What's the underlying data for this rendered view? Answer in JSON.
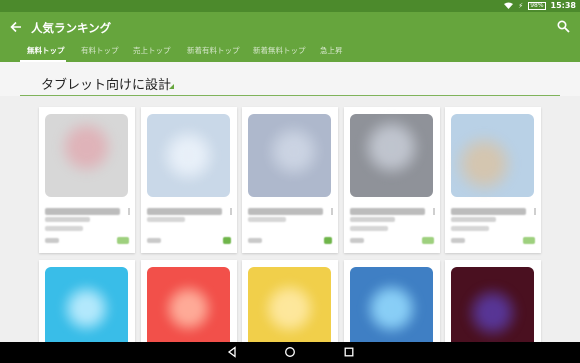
{
  "status_bar": {
    "battery": "98%",
    "time": "15:38"
  },
  "app_bar": {
    "title": "人気ランキング"
  },
  "tabs": [
    {
      "label": "無料トップ",
      "active": true
    },
    {
      "label": "有料トップ",
      "active": false
    },
    {
      "label": "売上トップ",
      "active": false
    },
    {
      "label": "新着有料トップ",
      "active": false
    },
    {
      "label": "新着無料トップ",
      "active": false
    },
    {
      "label": "急上昇",
      "active": false
    }
  ],
  "section": {
    "title": "タブレット向けに設計"
  },
  "colors": {
    "status_bar": "#4c8a2c",
    "app_bar": "#66a53d",
    "background": "#efefef"
  },
  "icons": [
    "back-arrow-icon",
    "search-icon",
    "wifi-icon",
    "battery-icon",
    "nav-back-icon",
    "nav-home-icon",
    "nav-recents-icon"
  ]
}
